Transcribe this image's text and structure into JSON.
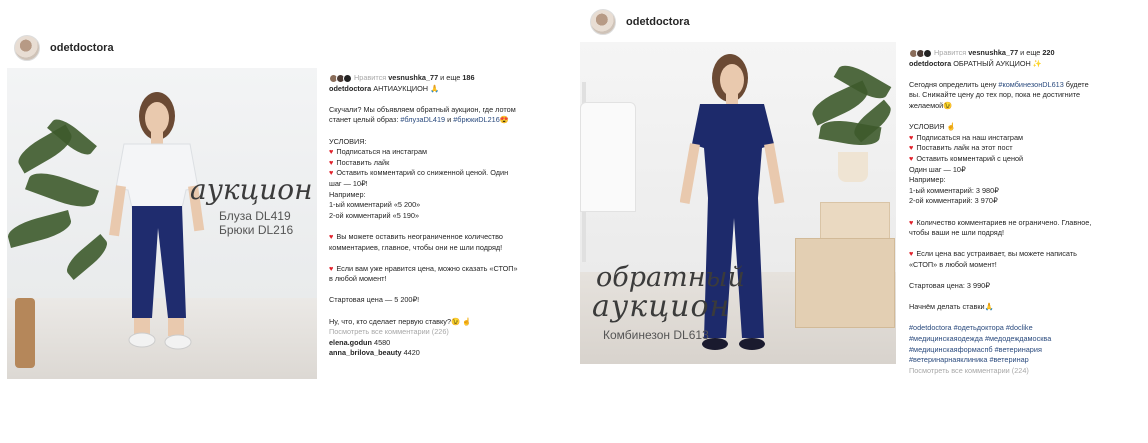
{
  "post1": {
    "username": "odetdoctora",
    "photo": {
      "title": "аукцион",
      "lines": [
        "Блуза DL419",
        "Брюки DL216"
      ]
    },
    "likes": {
      "prefix": "Нравится",
      "user": "vesnushka_77",
      "mid": "и еще",
      "count": "186"
    },
    "caption": {
      "user": "odetdoctora",
      "text": "АНТИАУКЦИОН"
    },
    "body": [
      {
        "parts": [
          {
            "t": "Скучали? Мы объявляем обратный аукцион, где лотом"
          }
        ]
      },
      {
        "parts": [
          {
            "t": "станет целый образ: "
          },
          {
            "t": "#блузаDL419",
            "c": "tag"
          },
          {
            "t": " и "
          },
          {
            "t": "#брюкиDL216",
            "c": "tag"
          },
          {
            "t": "😍"
          }
        ]
      },
      {
        "gap": true
      },
      {
        "parts": [
          {
            "t": "УСЛОВИЯ:"
          }
        ]
      },
      {
        "heart": true,
        "parts": [
          {
            "t": "Подписаться на инстаграм"
          }
        ]
      },
      {
        "heart": true,
        "parts": [
          {
            "t": "Поставить лайк"
          }
        ]
      },
      {
        "heart": true,
        "parts": [
          {
            "t": "Оставить комментарий со сниженной ценой. Один"
          }
        ]
      },
      {
        "parts": [
          {
            "t": "шаг — 10₽!"
          }
        ]
      },
      {
        "parts": [
          {
            "t": "Например:"
          }
        ]
      },
      {
        "parts": [
          {
            "t": "1-ый комментарий «5 200»"
          }
        ]
      },
      {
        "parts": [
          {
            "t": "2-ой комментарий «5 190»"
          }
        ]
      },
      {
        "gap": true
      },
      {
        "heart": true,
        "parts": [
          {
            "t": "Вы можете оставить неограниченное количество"
          }
        ]
      },
      {
        "parts": [
          {
            "t": "комментариев, главное, чтобы они не шли подряд!"
          }
        ]
      },
      {
        "gap": true
      },
      {
        "heart": true,
        "parts": [
          {
            "t": "Если вам уже нравится цена, можно сказать «СТОП»"
          }
        ]
      },
      {
        "parts": [
          {
            "t": "в любой момент!"
          }
        ]
      },
      {
        "gap": true
      },
      {
        "parts": [
          {
            "t": "Стартовая цена — 5 200₽!"
          }
        ]
      },
      {
        "gap": true
      },
      {
        "parts": [
          {
            "t": "Ну, что, кто сделает первую ставку?😉 ☝"
          }
        ]
      },
      {
        "parts": [
          {
            "t": "Посмотреть все комментарии (226)",
            "c": "grey"
          }
        ]
      },
      {
        "parts": [
          {
            "t": "elena.godun",
            "c": "b"
          },
          {
            "t": " 4580"
          }
        ]
      },
      {
        "parts": [
          {
            "t": "anna_brilova_beauty",
            "c": "b"
          },
          {
            "t": " 4420"
          }
        ]
      }
    ]
  },
  "post2": {
    "username": "odetdoctora",
    "photo": {
      "title_lines": [
        "обратный",
        "аукцион"
      ],
      "lines": [
        "Комбинезон DL613"
      ]
    },
    "likes": {
      "prefix": "Нравится",
      "user": "vesnushka_77",
      "mid": "и еще",
      "count": "220"
    },
    "caption": {
      "user": "odetdoctora",
      "text": "ОБРАТНЫЙ АУКЦИОН ✨"
    },
    "body": [
      {
        "parts": [
          {
            "t": "Сегодня определить цену "
          },
          {
            "t": "#комбинезонDL613",
            "c": "tag"
          },
          {
            "t": " будете"
          }
        ]
      },
      {
        "parts": [
          {
            "t": "вы. Снижайте цену до тех пор, пока не достигните"
          }
        ]
      },
      {
        "parts": [
          {
            "t": "желаемой😉"
          }
        ]
      },
      {
        "gap": true
      },
      {
        "parts": [
          {
            "t": "УСЛОВИЯ ☝"
          }
        ]
      },
      {
        "heart": true,
        "parts": [
          {
            "t": "Подписаться на наш инстаграм"
          }
        ]
      },
      {
        "heart": true,
        "parts": [
          {
            "t": "Поставить лайк на этот пост"
          }
        ]
      },
      {
        "heart": true,
        "parts": [
          {
            "t": "Оставить комментарий с ценой"
          }
        ]
      },
      {
        "parts": [
          {
            "t": "Один шаг — 10₽"
          }
        ]
      },
      {
        "parts": [
          {
            "t": "Например:"
          }
        ]
      },
      {
        "parts": [
          {
            "t": "1-ый комментарий: 3 980₽"
          }
        ]
      },
      {
        "parts": [
          {
            "t": "2-ой комментарий: 3 970₽"
          }
        ]
      },
      {
        "gap": true
      },
      {
        "heart": true,
        "parts": [
          {
            "t": "Количество комментариев не ограничено. Главное,"
          }
        ]
      },
      {
        "parts": [
          {
            "t": "чтобы ваши не шли подряд!"
          }
        ]
      },
      {
        "gap": true
      },
      {
        "heart": true,
        "parts": [
          {
            "t": "Если цена вас устраивает, вы можете написать"
          }
        ]
      },
      {
        "parts": [
          {
            "t": "«СТОП» в любой момент!"
          }
        ]
      },
      {
        "gap": true
      },
      {
        "parts": [
          {
            "t": "Стартовая цена: 3 990₽"
          }
        ]
      },
      {
        "gap": true
      },
      {
        "parts": [
          {
            "t": "Начнём делать ставки🙏"
          }
        ]
      },
      {
        "gap": true
      },
      {
        "parts": [
          {
            "t": "#odetdoctora #одетьдоктора #doclike",
            "c": "tag"
          }
        ]
      },
      {
        "parts": [
          {
            "t": "#медицинскаяодежда #медодеждамосква",
            "c": "tag"
          }
        ]
      },
      {
        "parts": [
          {
            "t": "#медицинскаяформаспб #ветеринария",
            "c": "tag"
          }
        ]
      },
      {
        "parts": [
          {
            "t": "#ветеринарнаяклиника #ветеринар",
            "c": "tag"
          }
        ]
      },
      {
        "parts": [
          {
            "t": "Посмотреть все комментарии (224)",
            "c": "grey"
          }
        ]
      }
    ]
  },
  "colors": {
    "tag": "#2b4b7e",
    "heart": "#e0202a",
    "navy": "#1d2a6b"
  }
}
